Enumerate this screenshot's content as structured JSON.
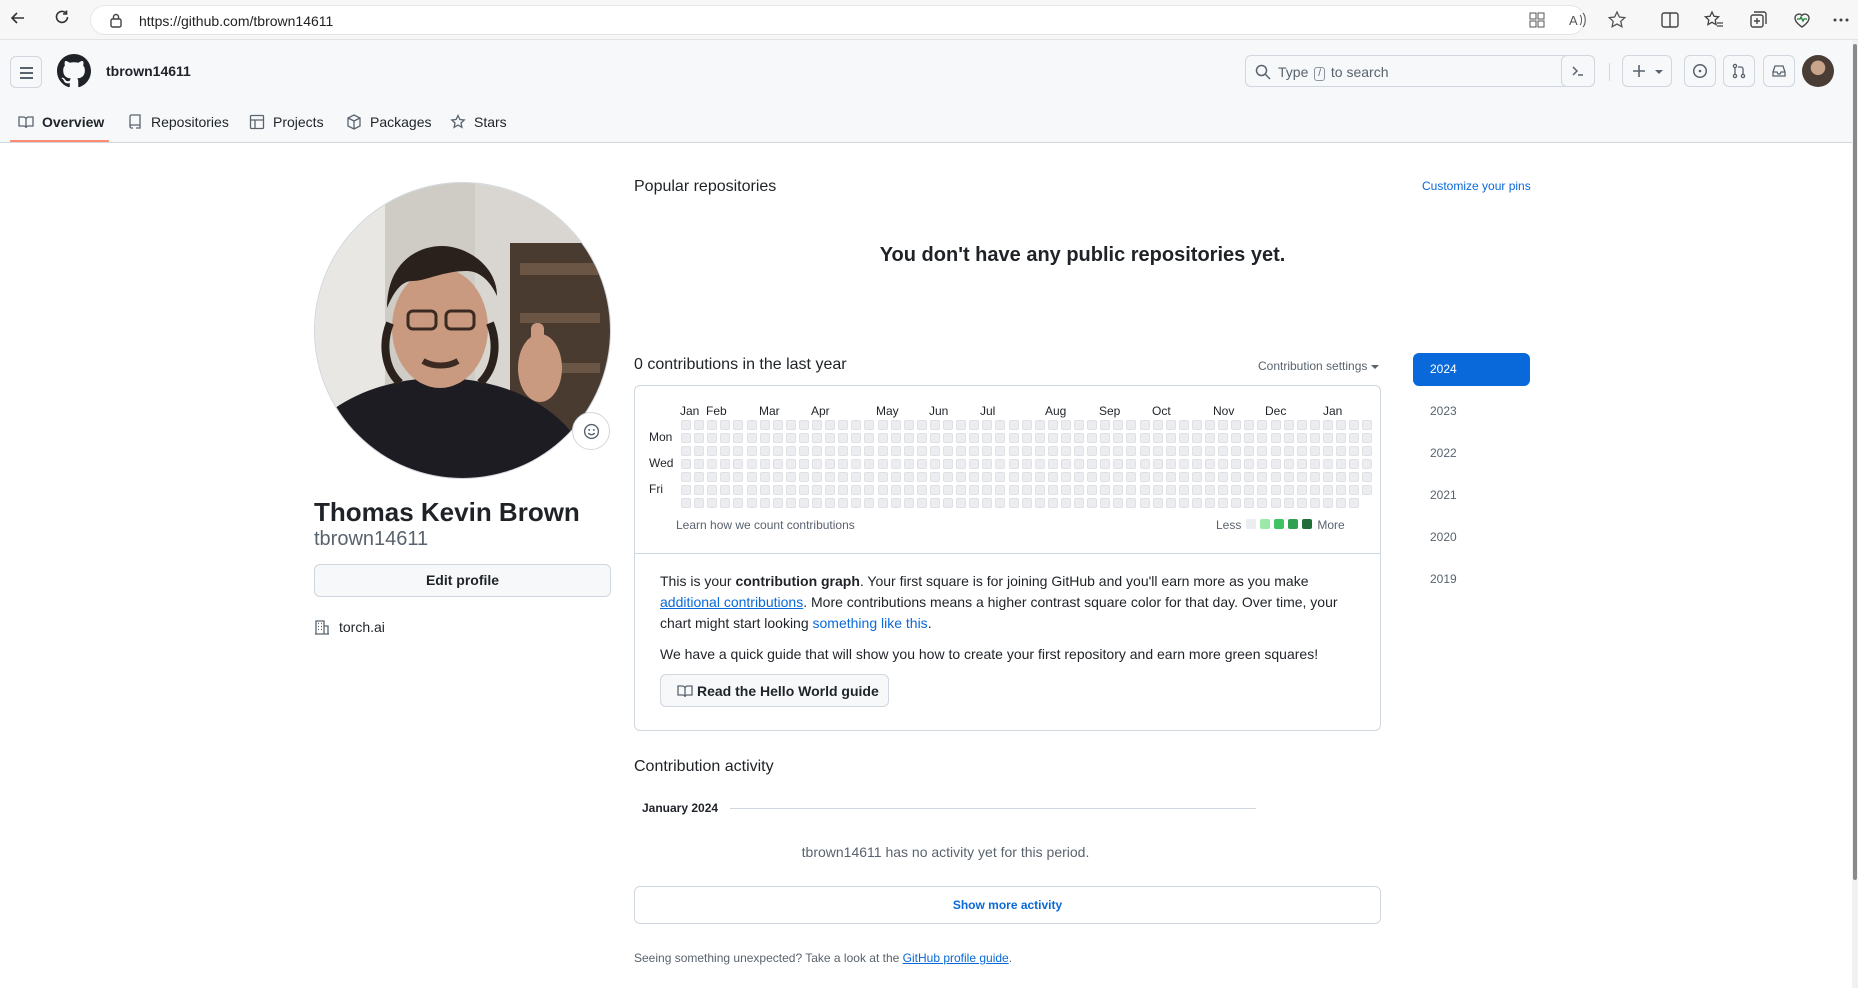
{
  "browser": {
    "url": "https://github.com/tbrown14611"
  },
  "header": {
    "username": "tbrown14611",
    "search_prefix": "Type",
    "search_key": "/",
    "search_suffix": "to search"
  },
  "tabs": [
    {
      "label": "Overview",
      "active": true
    },
    {
      "label": "Repositories"
    },
    {
      "label": "Projects"
    },
    {
      "label": "Packages"
    },
    {
      "label": "Stars"
    }
  ],
  "profile": {
    "full_name": "Thomas Kevin Brown",
    "username": "tbrown14611",
    "edit_label": "Edit profile",
    "organization": "torch.ai"
  },
  "popular": {
    "title": "Popular repositories",
    "customize": "Customize your pins",
    "empty": "You don't have any public repositories yet."
  },
  "contributions": {
    "title": "0 contributions in the last year",
    "settings": "Contribution settings",
    "months": [
      "Jan",
      "Feb",
      "Mar",
      "Apr",
      "May",
      "Jun",
      "Jul",
      "Aug",
      "Sep",
      "Oct",
      "Nov",
      "Dec",
      "Jan"
    ],
    "days": [
      "Mon",
      "Wed",
      "Fri"
    ],
    "learn": "Learn how we count contributions",
    "legend_less": "Less",
    "legend_more": "More",
    "legend_colors": [
      "#ebedf0",
      "#9be9a8",
      "#40c463",
      "#30a14e",
      "#216e39"
    ],
    "explain_1": "This is your",
    "explain_bold": "contribution graph",
    "explain_2": ". Your first square is for joining GitHub and you'll earn more as you make",
    "explain_link1": "additional contributions",
    "explain_3": ". More contributions means a higher contrast square color for that day. Over time, your chart might start looking",
    "explain_link2": "something like this",
    "explain_4": ".",
    "guide_text": "We have a quick guide that will show you how to create your first repository and earn more green squares!",
    "guide_button": "Read the Hello World guide"
  },
  "activity": {
    "title": "Contribution activity",
    "month": "January 2024",
    "empty": "tbrown14611 has no activity yet for this period.",
    "show_more": "Show more activity",
    "footer_prefix": "Seeing something unexpected? Take a look at the",
    "footer_link": "GitHub profile guide",
    "footer_suffix": "."
  },
  "years": [
    "2024",
    "2023",
    "2022",
    "2021",
    "2020",
    "2019"
  ]
}
